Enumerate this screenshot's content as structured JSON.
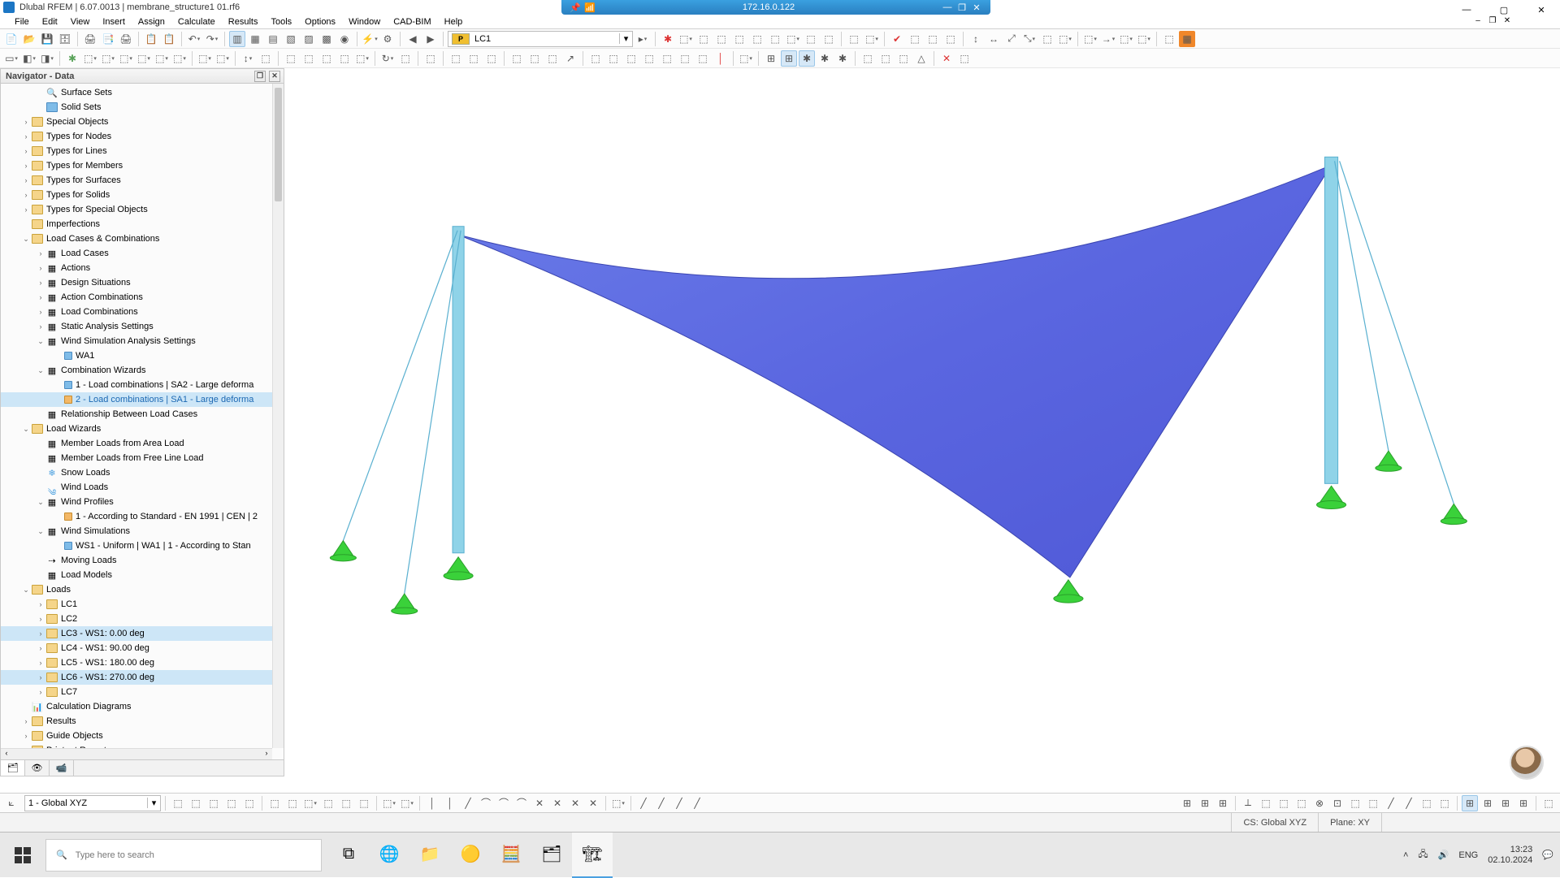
{
  "remote": {
    "ip": "172.16.0.122"
  },
  "app": {
    "title": "Dlubal RFEM | 6.07.0013 | membrane_structure1 01.rf6"
  },
  "menu": [
    "File",
    "Edit",
    "View",
    "Insert",
    "Assign",
    "Calculate",
    "Results",
    "Tools",
    "Options",
    "Window",
    "CAD-BIM",
    "Help"
  ],
  "lc": {
    "chip": "P",
    "name": "LC1"
  },
  "navigator": {
    "title": "Navigator - Data"
  },
  "tree": {
    "surfaceSets": "Surface Sets",
    "solidSets": "Solid Sets",
    "specialObjects": "Special Objects",
    "typesNodes": "Types for Nodes",
    "typesLines": "Types for Lines",
    "typesMembers": "Types for Members",
    "typesSurfaces": "Types for Surfaces",
    "typesSolids": "Types for Solids",
    "typesSpecial": "Types for Special Objects",
    "imperfections": "Imperfections",
    "lcComb": "Load Cases & Combinations",
    "loadCases": "Load Cases",
    "actions": "Actions",
    "designSit": "Design Situations",
    "actionComb": "Action Combinations",
    "loadComb": "Load Combinations",
    "staticAna": "Static Analysis Settings",
    "windSimAna": "Wind Simulation Analysis Settings",
    "wa1": "WA1",
    "combWiz": "Combination Wizards",
    "cw1": "1 - Load combinations | SA2 - Large deforma",
    "cw2": "2 - Load combinations | SA1 - Large deforma",
    "relBetween": "Relationship Between Load Cases",
    "loadWizards": "Load Wizards",
    "memberArea": "Member Loads from Area Load",
    "memberLine": "Member Loads from Free Line Load",
    "snow": "Snow Loads",
    "wind": "Wind Loads",
    "windProfiles": "Wind Profiles",
    "wp1": "1 - According to Standard - EN 1991 | CEN | 2",
    "windSim": "Wind Simulations",
    "ws1": "WS1 - Uniform | WA1 | 1 - According to Stan",
    "moving": "Moving Loads",
    "loadModels": "Load Models",
    "loads": "Loads",
    "lc1": "LC1",
    "lc2": "LC2",
    "lc3": "LC3 - WS1: 0.00 deg",
    "lc4": "LC4 - WS1: 90.00 deg",
    "lc5": "LC5 - WS1: 180.00 deg",
    "lc6": "LC6 - WS1: 270.00 deg",
    "lc7": "LC7",
    "calcDiag": "Calculation Diagrams",
    "results": "Results",
    "guide": "Guide Objects",
    "printout": "Printout Reports"
  },
  "cs": {
    "label": "1 - Global XYZ",
    "status": "CS: Global XYZ",
    "plane": "Plane: XY"
  },
  "taskbar": {
    "search": "Type here to search",
    "lang": "ENG",
    "time": "13:23",
    "date": "02.10.2024"
  }
}
